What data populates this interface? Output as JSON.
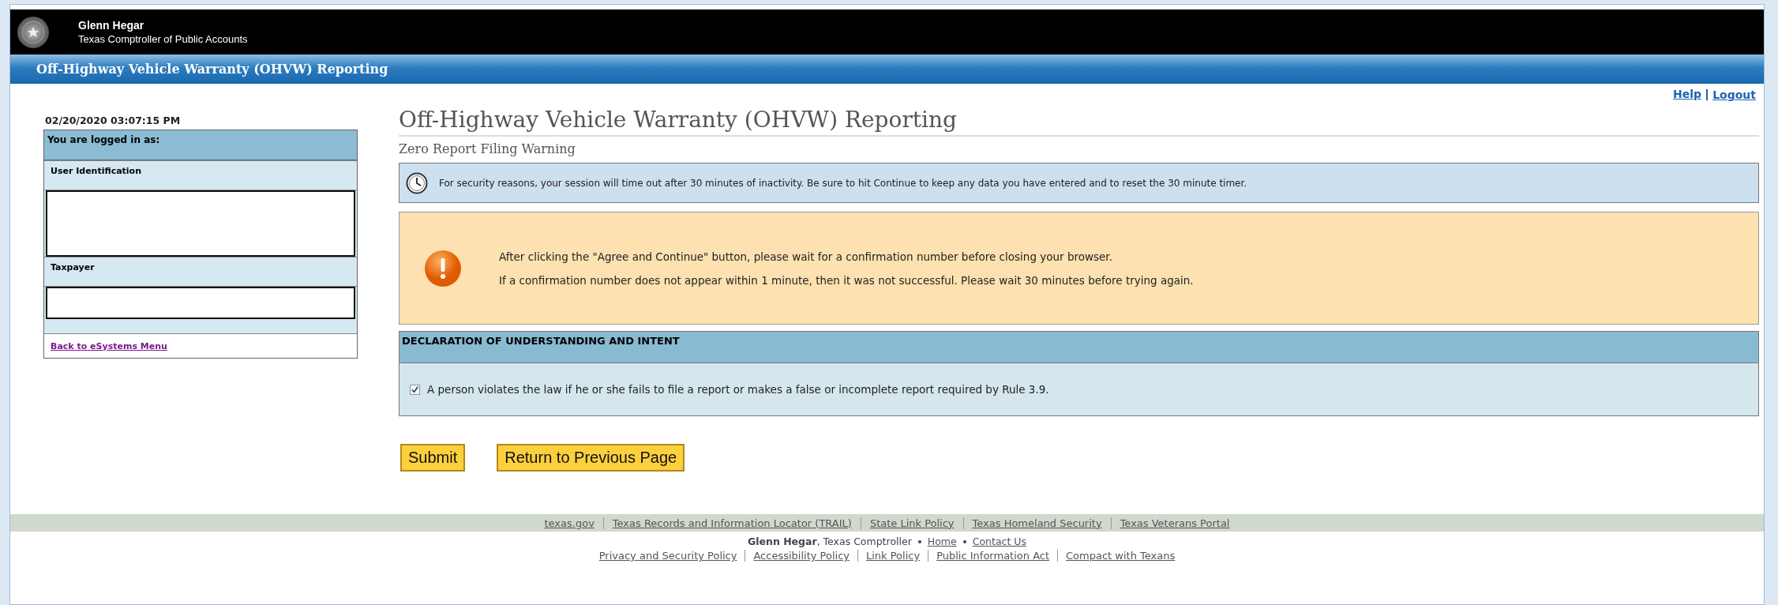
{
  "header": {
    "name": "Glenn Hegar",
    "subtitle": "Texas Comptroller of Public Accounts"
  },
  "app_bar": {
    "title": "Off-Highway Vehicle Warranty (OHVW) Reporting"
  },
  "top_links": [
    "Help",
    "Logout"
  ],
  "sidebar": {
    "timestamp": "02/20/2020 03:07:15 PM",
    "heading": "You are logged in as:",
    "sections": [
      {
        "label": "User Identification",
        "kind": "tall"
      },
      {
        "label": "Taxpayer",
        "kind": "short"
      }
    ],
    "link": "Back to eSystems Menu"
  },
  "main": {
    "title": "Off-Highway Vehicle Warranty (OHVW) Reporting",
    "subtitle": "Zero Report Filing Warning",
    "session_notice": "For security reasons, your session will time out after 30 minutes of inactivity. Be sure to hit Continue to keep any data you have entered and to reset the 30 minute timer.",
    "warning_lines": [
      "After clicking the \"Agree and Continue\" button, please wait for a confirmation number before closing your browser.",
      "If a confirmation number does not appear within 1 minute, then it was not successful. Please wait 30 minutes before trying again."
    ],
    "declaration": {
      "heading": "DECLARATION OF UNDERSTANDING AND INTENT",
      "statement": "A person violates the law if he or she fails to file a report or makes a false or incomplete report required by Rule 3.9.",
      "checked": true
    }
  },
  "buttons": [
    "Submit",
    "Return to Previous Page"
  ],
  "footer": {
    "links": [
      "texas.gov",
      "Texas Records and Information Locator (TRAIL)",
      "State Link Policy",
      "Texas Homeland Security",
      "Texas Veterans Portal"
    ],
    "credit_line": [
      {
        "kind": "text",
        "text": "**Glenn Hegar**, Texas Comptroller"
      },
      {
        "kind": "link",
        "text": "Home"
      },
      {
        "kind": "link",
        "text": "Contact Us"
      }
    ],
    "policy_links": [
      "Privacy and Security Policy",
      "Accessibility Policy",
      "Link Policy",
      "Public Information Act",
      "Compact with Texans"
    ]
  }
}
